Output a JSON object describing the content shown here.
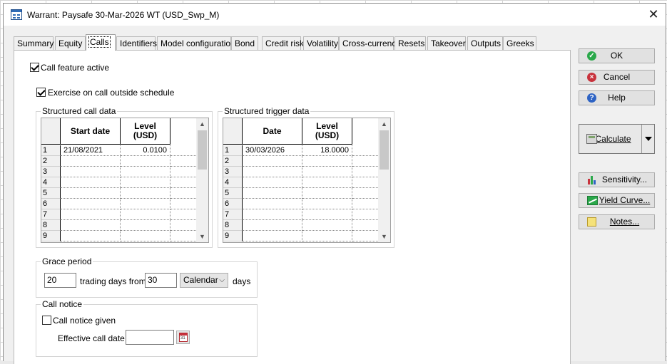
{
  "window": {
    "title": "Warrant: Paysafe 30-Mar-2026 WT (USD_Swp_M)"
  },
  "tabs": [
    {
      "label": "Summary"
    },
    {
      "label": "Equity"
    },
    {
      "label": "Calls"
    },
    {
      "label": "Identifiers"
    },
    {
      "label": "Model configuration"
    },
    {
      "label": "Bond"
    },
    {
      "label": "Credit risk"
    },
    {
      "label": "Volatility"
    },
    {
      "label": "Cross-currency"
    },
    {
      "label": "Resets"
    },
    {
      "label": "Takeover"
    },
    {
      "label": "Outputs"
    },
    {
      "label": "Greeks"
    }
  ],
  "active_tab": "Calls",
  "call_feature_active": {
    "label": "Call feature active",
    "checked": true
  },
  "exercise_outside": {
    "label": "Exercise on call outside schedule",
    "checked": true
  },
  "structured_call": {
    "title": "Structured call data",
    "headers": [
      "Start date",
      "Level\n(USD)"
    ],
    "rows": [
      {
        "n": "1",
        "a": "21/08/2021",
        "b": "0.0100"
      },
      {
        "n": "2",
        "a": "",
        "b": ""
      },
      {
        "n": "3",
        "a": "",
        "b": ""
      },
      {
        "n": "4",
        "a": "",
        "b": ""
      },
      {
        "n": "5",
        "a": "",
        "b": ""
      },
      {
        "n": "6",
        "a": "",
        "b": ""
      },
      {
        "n": "7",
        "a": "",
        "b": ""
      },
      {
        "n": "8",
        "a": "",
        "b": ""
      },
      {
        "n": "9",
        "a": "",
        "b": ""
      }
    ]
  },
  "structured_trigger": {
    "title": "Structured trigger data",
    "headers": [
      "Date",
      "Level\n(USD)"
    ],
    "rows": [
      {
        "n": "1",
        "a": "30/03/2026",
        "b": "18.0000"
      },
      {
        "n": "2",
        "a": "",
        "b": ""
      },
      {
        "n": "3",
        "a": "",
        "b": ""
      },
      {
        "n": "4",
        "a": "",
        "b": ""
      },
      {
        "n": "5",
        "a": "",
        "b": ""
      },
      {
        "n": "6",
        "a": "",
        "b": ""
      },
      {
        "n": "7",
        "a": "",
        "b": ""
      },
      {
        "n": "8",
        "a": "",
        "b": ""
      },
      {
        "n": "9",
        "a": "",
        "b": ""
      }
    ]
  },
  "grace_period": {
    "title": "Grace period",
    "days_value": "20",
    "mid_label": "trading days from",
    "from_value": "30",
    "calendar_option": "Calendar",
    "end_label": "days"
  },
  "call_notice": {
    "title": "Call notice",
    "given_label": "Call notice given",
    "given_checked": false,
    "effective_label": "Effective call date",
    "effective_value": ""
  },
  "buttons": {
    "ok": "OK",
    "cancel": "Cancel",
    "help": "Help",
    "calculate": "Calculate",
    "sensitivity": "Sensitivity...",
    "yield_curve": "Yield Curve...",
    "notes": "Notes..."
  },
  "icons": {
    "ok": "check-circle-icon",
    "cancel": "x-circle-icon",
    "help": "question-circle-icon",
    "calculate": "calculator-icon",
    "sensitivity": "bar-chart-icon",
    "yield_curve": "line-chart-icon",
    "notes": "note-pencil-icon",
    "calendar": "calendar-icon"
  },
  "colors": {
    "ok": "#2aa84a",
    "cancel": "#c8323c",
    "help": "#2e63c4"
  }
}
